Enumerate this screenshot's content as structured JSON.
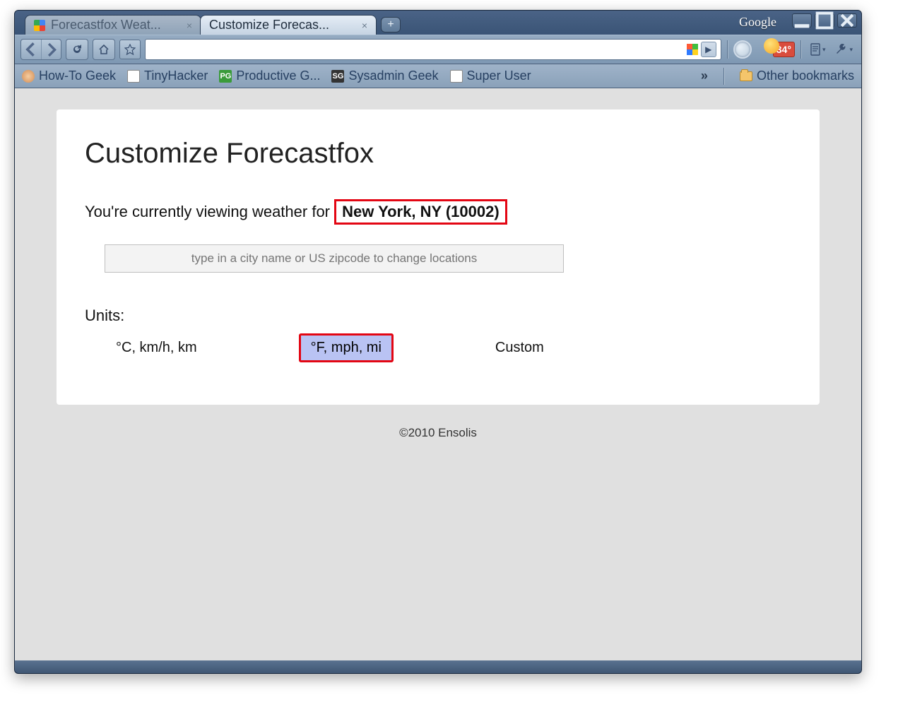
{
  "window": {
    "brand": "Google",
    "tabs": [
      {
        "title": "Forecastfox Weat...",
        "active": false
      },
      {
        "title": "Customize Forecas...",
        "active": true
      }
    ]
  },
  "toolbar": {
    "url": "",
    "temp_badge": "34°",
    "bookmarks": [
      {
        "label": "How-To Geek",
        "icon": "face"
      },
      {
        "label": "TinyHacker",
        "icon": "doc"
      },
      {
        "label": "Productive G...",
        "icon": "pg"
      },
      {
        "label": "Sysadmin Geek",
        "icon": "sg"
      },
      {
        "label": "Super User",
        "icon": "su"
      }
    ],
    "overflow_bookmarks_label": "»",
    "other_bookmarks_label": "Other bookmarks"
  },
  "page": {
    "heading": "Customize Forecastfox",
    "viewing_prefix": "You're currently viewing weather for ",
    "location": "New York, NY (10002)",
    "location_placeholder": "type in a city name or US zipcode to change locations",
    "units_label": "Units:",
    "unit_options": [
      {
        "label": "°C, km/h, km",
        "selected": false
      },
      {
        "label": "°F, mph, mi",
        "selected": true
      },
      {
        "label": "Custom",
        "selected": false
      }
    ],
    "footer": "©2010 Ensolis"
  }
}
